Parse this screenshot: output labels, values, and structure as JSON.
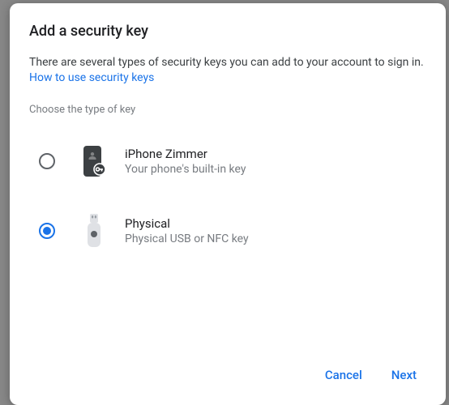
{
  "dialog": {
    "title": "Add a security key",
    "intro": "There are several types of security keys you can add to your account to sign in.",
    "help_link": "How to use security keys",
    "choose_label": "Choose the type of key"
  },
  "options": {
    "phone": {
      "title": "iPhone Zimmer",
      "subtitle": "Your phone's built-in key",
      "selected": false
    },
    "physical": {
      "title": "Physical",
      "subtitle": "Physical USB or NFC key",
      "selected": true
    }
  },
  "buttons": {
    "cancel": "Cancel",
    "next": "Next"
  }
}
